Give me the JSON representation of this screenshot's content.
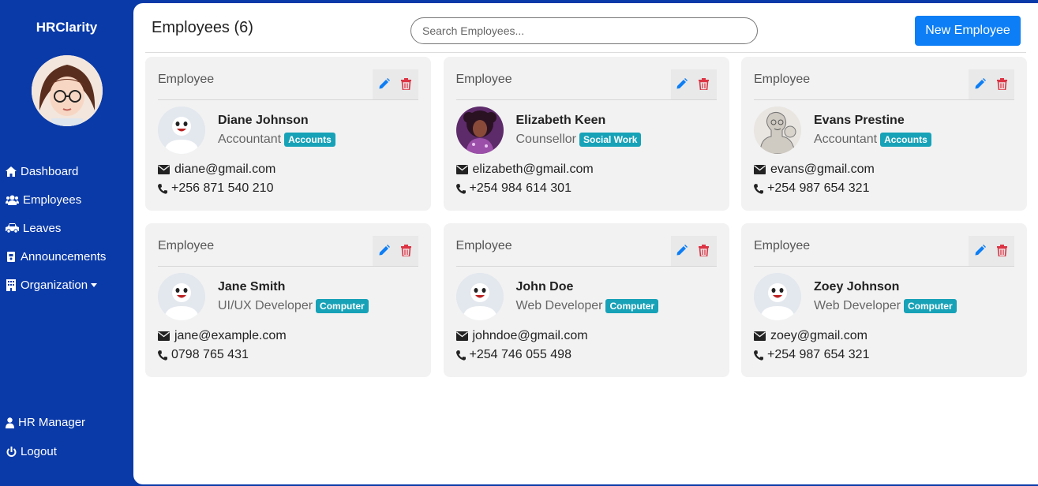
{
  "app": {
    "brand": "HRClarity"
  },
  "sidebar": {
    "items": [
      {
        "label": "Dashboard",
        "icon": "home-icon"
      },
      {
        "label": "Employees",
        "icon": "users-icon"
      },
      {
        "label": "Leaves",
        "icon": "car-icon"
      },
      {
        "label": "Announcements",
        "icon": "bullhorn-icon"
      },
      {
        "label": "Organization",
        "icon": "building-icon"
      }
    ],
    "bottom": [
      {
        "label": "HR Manager",
        "icon": "user-icon"
      },
      {
        "label": "Logout",
        "icon": "power-icon"
      }
    ]
  },
  "main": {
    "title": "Employees (6)",
    "search_placeholder": "Search Employees...",
    "new_button": "New Employee"
  },
  "employees": [
    {
      "header": "Employee",
      "name": "Diane Johnson",
      "role": "Accountant",
      "dept": "Accounts",
      "email": "diane@gmail.com",
      "phone": "+256 871 540 210",
      "avatar": "default-avatar"
    },
    {
      "header": "Employee",
      "name": "Elizabeth Keen",
      "role": "Counsellor",
      "dept": "Social Work",
      "email": "elizabeth@gmail.com",
      "phone": "+254 984 614 301",
      "avatar": "photo-avatar"
    },
    {
      "header": "Employee",
      "name": "Evans Prestine",
      "role": "Accountant",
      "dept": "Accounts",
      "email": "evans@gmail.com",
      "phone": "+254 987 654 321",
      "avatar": "sketch-avatar"
    },
    {
      "header": "Employee",
      "name": "Jane Smith",
      "role": "UI/UX Developer",
      "dept": "Computer",
      "email": "jane@example.com",
      "phone": "0798 765 431",
      "avatar": "default-avatar"
    },
    {
      "header": "Employee",
      "name": "John Doe",
      "role": "Web Developer",
      "dept": "Computer",
      "email": "johndoe@gmail.com",
      "phone": "+254 746 055 498",
      "avatar": "default-avatar"
    },
    {
      "header": "Employee",
      "name": "Zoey Johnson",
      "role": "Web Developer",
      "dept": "Computer",
      "email": "zoey@gmail.com",
      "phone": "+254 987 654 321",
      "avatar": "default-avatar"
    }
  ],
  "colors": {
    "sidebar": "#0a3aa8",
    "primary": "#0d7ef5",
    "badge": "#17a2b8",
    "delete": "#dc3545"
  }
}
